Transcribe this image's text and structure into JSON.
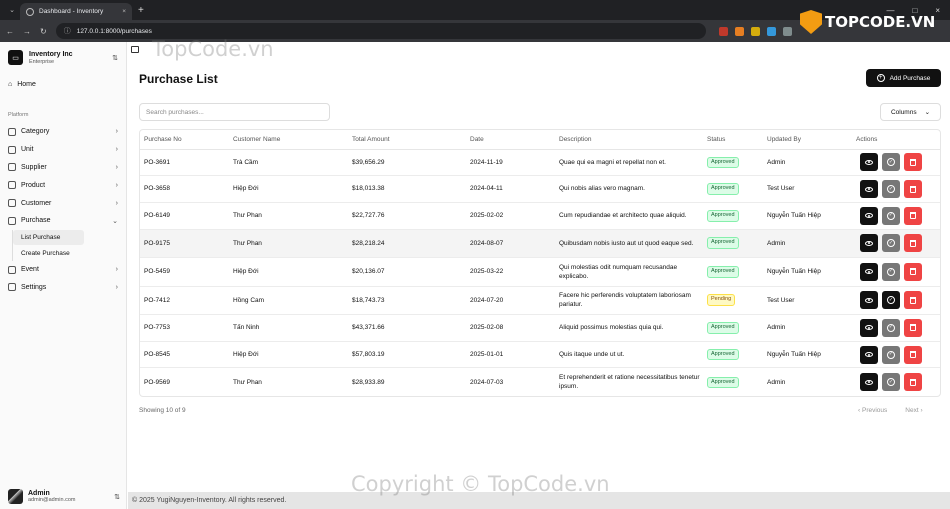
{
  "browser": {
    "tab_title": "Dashboard - Inventory",
    "url": "127.0.0.1:8000/purchases",
    "new_tab_symbol": "+",
    "tab_close_symbol": "×",
    "window_controls": [
      "—",
      "□",
      "×"
    ]
  },
  "watermark": {
    "logo_text": "TOPCODE.VN",
    "text_top": "TopCode.vn",
    "text_bottom": "Copyright © TopCode.vn"
  },
  "sidebar": {
    "org_name": "Inventory Inc",
    "org_plan": "Enterprise",
    "home": "Home",
    "section_label": "Platform",
    "items": [
      {
        "label": "Category"
      },
      {
        "label": "Unit"
      },
      {
        "label": "Supplier"
      },
      {
        "label": "Product"
      },
      {
        "label": "Customer"
      },
      {
        "label": "Purchase"
      }
    ],
    "purchase_sub": [
      "List Purchase",
      "Create Purchase"
    ],
    "items_after": [
      {
        "label": "Event"
      },
      {
        "label": "Settings"
      }
    ],
    "user_name": "Admin",
    "user_email": "admin@admin.com"
  },
  "main": {
    "title": "Purchase List",
    "add_button": "Add Purchase",
    "search_placeholder": "Search purchases...",
    "columns_button": "Columns",
    "headers": [
      "Purchase No",
      "Customer Name",
      "Total Amount",
      "Date",
      "Description",
      "Status",
      "Updated By",
      "Actions"
    ],
    "rows": [
      {
        "no": "PO-3691",
        "customer": "Trà Cầm",
        "amount": "$39,656.29",
        "date": "2024-11-19",
        "desc": "Quae qui ea magni et repellat non et.",
        "status": "Approved",
        "updated_by": "Admin"
      },
      {
        "no": "PO-3658",
        "customer": "Hiệp Đới",
        "amount": "$18,013.38",
        "date": "2024-04-11",
        "desc": "Qui nobis alias vero magnam.",
        "status": "Approved",
        "updated_by": "Test User"
      },
      {
        "no": "PO-6149",
        "customer": "Thư Phan",
        "amount": "$22,727.76",
        "date": "2025-02-02",
        "desc": "Cum repudiandae et architecto quae aliquid.",
        "status": "Approved",
        "updated_by": "Nguyễn Tuấn Hiệp"
      },
      {
        "no": "PO-9175",
        "customer": "Thư Phan",
        "amount": "$28,218.24",
        "date": "2024-08-07",
        "desc": "Quibusdam nobis iusto aut ut quod eaque sed.",
        "status": "Approved",
        "updated_by": "Admin"
      },
      {
        "no": "PO-5459",
        "customer": "Hiệp Đới",
        "amount": "$20,136.07",
        "date": "2025-03-22",
        "desc": "Qui molestias odit numquam recusandae explicabo.",
        "status": "Approved",
        "updated_by": "Nguyễn Tuấn Hiệp"
      },
      {
        "no": "PO-7412",
        "customer": "Hồng Cam",
        "amount": "$18,743.73",
        "date": "2024-07-20",
        "desc": "Facere hic perferendis voluptatem laboriosam pariatur.",
        "status": "Pending",
        "updated_by": "Test User"
      },
      {
        "no": "PO-7753",
        "customer": "Tấn Ninh",
        "amount": "$43,371.66",
        "date": "2025-02-08",
        "desc": "Aliquid possimus molestias quia qui.",
        "status": "Approved",
        "updated_by": "Admin"
      },
      {
        "no": "PO-8545",
        "customer": "Hiệp Đới",
        "amount": "$57,803.19",
        "date": "2025-01-01",
        "desc": "Quis itaque unde ut ut.",
        "status": "Approved",
        "updated_by": "Nguyễn Tuấn Hiệp"
      },
      {
        "no": "PO-9569",
        "customer": "Thư Phan",
        "amount": "$28,933.89",
        "date": "2024-07-03",
        "desc": "Et reprehenderit et ratione necessitatibus tenetur ipsum.",
        "status": "Approved",
        "updated_by": "Admin"
      }
    ],
    "showing": "Showing 10 of 9",
    "prev": "Previous",
    "next": "Next",
    "footer": "© 2025 YugiNguyen-Inventory. All rights reserved."
  },
  "icons": {
    "chevron": "›",
    "chevron_down": "⌄",
    "selector": "⇅"
  },
  "colors": {
    "approved_bg": "#dcfce7",
    "pending_bg": "#fef9c3",
    "delete": "#ef4444",
    "primary": "#111111"
  }
}
